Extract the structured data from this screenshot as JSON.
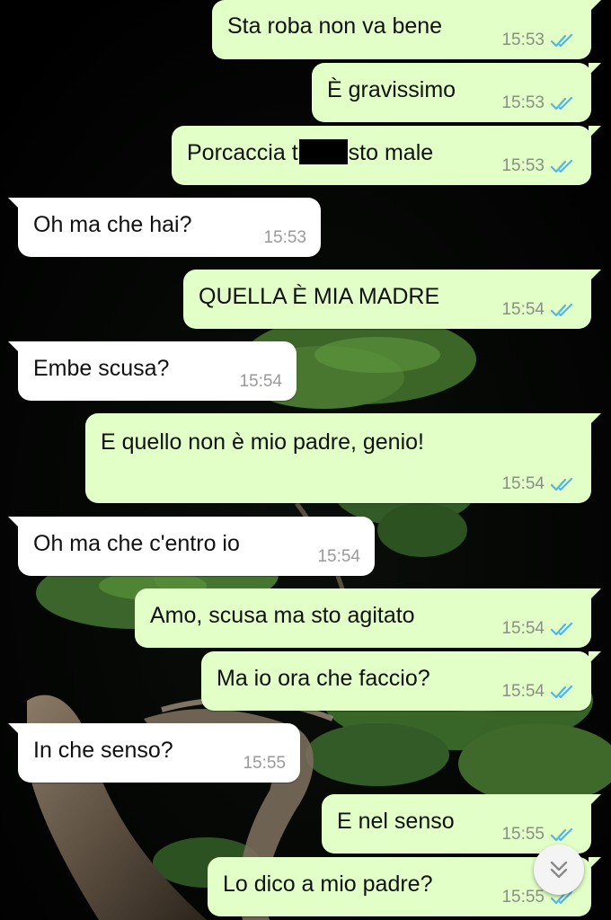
{
  "colors": {
    "outgoing_bubble": "#e2ffc7",
    "incoming_bubble": "#ffffff",
    "read_ticks": "#4fb6ec",
    "timestamp": "#8a8f86"
  },
  "messages": [
    {
      "direction": "out",
      "text_before": "Sta roba non va bene",
      "time": "15:53",
      "ticks": "read-double-check-icon"
    },
    {
      "direction": "out",
      "text_before": "È gravissimo",
      "time": "15:53",
      "ticks": "read-double-check-icon"
    },
    {
      "direction": "out",
      "text_before": "Porcaccia t",
      "redacted": true,
      "text_after": "sto male",
      "time": "15:53",
      "ticks": "read-double-check-icon"
    },
    {
      "direction": "in",
      "text_before": "Oh ma che hai?",
      "time": "15:53"
    },
    {
      "direction": "out",
      "text_before": "QUELLA È MIA MADRE",
      "time": "15:54",
      "ticks": "read-double-check-icon"
    },
    {
      "direction": "in",
      "text_before": "Embe scusa?",
      "time": "15:54"
    },
    {
      "direction": "out",
      "text_before": "E quello non è mio padre, genio!",
      "time": "15:54",
      "ticks": "read-double-check-icon"
    },
    {
      "direction": "in",
      "text_before": "Oh ma che c'entro io",
      "time": "15:54"
    },
    {
      "direction": "out",
      "text_before": "Amo, scusa ma sto agitato",
      "time": "15:54",
      "ticks": "read-double-check-icon"
    },
    {
      "direction": "out",
      "text_before": "Ma io ora che faccio?",
      "time": "15:54",
      "ticks": "read-double-check-icon"
    },
    {
      "direction": "in",
      "text_before": "In che senso?",
      "time": "15:55"
    },
    {
      "direction": "out",
      "text_before": "E nel senso",
      "time": "15:55",
      "ticks": "read-double-check-icon"
    },
    {
      "direction": "out",
      "text_before": "Lo dico a mio padre?",
      "time": "15:55",
      "ticks": "read-double-check-icon"
    }
  ],
  "wallpaper": {
    "subject": "bonsai-tree-wallpaper"
  },
  "scroll_button": {
    "icon": "double-chevron-down-icon"
  }
}
